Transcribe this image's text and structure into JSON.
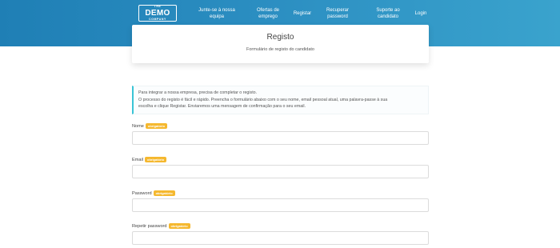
{
  "logo": {
    "top": "THE",
    "main": "DEMO",
    "bottom": "COMPANY"
  },
  "nav": [
    {
      "line1": "Junte-se à nossa",
      "line2": "equipa"
    },
    {
      "line1": "Ofertas de",
      "line2": "emprego"
    },
    {
      "line1": "Registar",
      "line2": ""
    },
    {
      "line1": "Recuperar",
      "line2": "password"
    },
    {
      "line1": "Suporte ao",
      "line2": "candidato"
    },
    {
      "line1": "Login",
      "line2": ""
    }
  ],
  "hero": {
    "title": "Registo",
    "subtitle": "Formulário de registo do candidato"
  },
  "info": {
    "line1": "Para integrar a nossa empresa, precisa de completar o registo.",
    "line2": "O processo do registo é fácil e rápido. Preencha o formulário abaixo com o seu nome, email pessoal atual, uma palavra-passe à sua",
    "line3": "escolha e clique Registar. Enviaremos uma mensagem de confirmação para o seu email."
  },
  "form": {
    "required_label": "obrigatório",
    "fields": [
      {
        "label": "Nome",
        "value": ""
      },
      {
        "label": "Email",
        "value": ""
      },
      {
        "label": "Password",
        "value": ""
      },
      {
        "label": "Repetir password",
        "value": ""
      }
    ]
  },
  "colors": {
    "header_start": "#1f7fb5",
    "header_end": "#3aa3cd",
    "badge": "#f5b82e",
    "info_border": "#3ac4d6"
  }
}
